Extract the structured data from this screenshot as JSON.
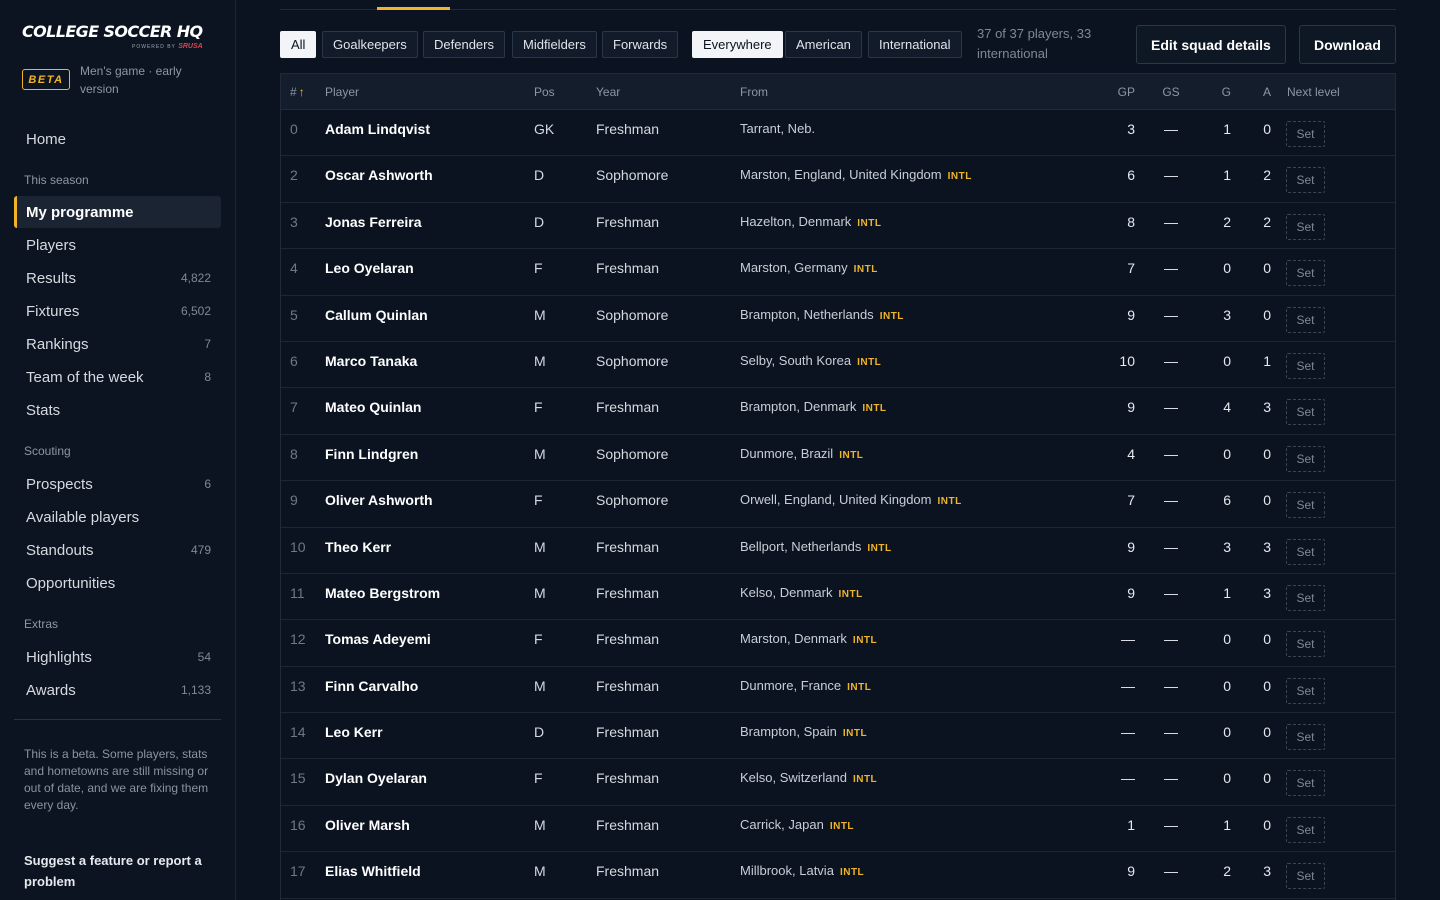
{
  "app": {
    "logo_main": "COLLEGE SOCCER HQ",
    "logo_powered": "POWERED BY",
    "logo_brand": "SRUSA",
    "beta_label": "BETA",
    "beta_text": "Men's game · early version"
  },
  "sidebar": {
    "home": "Home",
    "section_season": "This season",
    "season_items": [
      {
        "label": "My programme",
        "count": ""
      },
      {
        "label": "Players",
        "count": ""
      },
      {
        "label": "Results",
        "count": "4,822"
      },
      {
        "label": "Fixtures",
        "count": "6,502"
      },
      {
        "label": "Rankings",
        "count": "7"
      },
      {
        "label": "Team of the week",
        "count": "8"
      },
      {
        "label": "Stats",
        "count": ""
      }
    ],
    "section_scouting": "Scouting",
    "scouting_items": [
      {
        "label": "Prospects",
        "count": "6"
      },
      {
        "label": "Available players",
        "count": ""
      },
      {
        "label": "Standouts",
        "count": "479"
      },
      {
        "label": "Opportunities",
        "count": ""
      }
    ],
    "section_extras": "Extras",
    "extras_items": [
      {
        "label": "Highlights",
        "count": "54"
      },
      {
        "label": "Awards",
        "count": "1,133"
      }
    ],
    "note": "This is a beta. Some players, stats and hometowns are still missing or out of date, and we are fixing them every day.",
    "feedback_link": "Suggest a feature or report a problem"
  },
  "filters": {
    "positions": [
      "All",
      "Goalkeepers",
      "Defenders",
      "Midfielders",
      "Forwards"
    ],
    "origins": [
      "Everywhere",
      "American",
      "International"
    ],
    "selected_position": "All",
    "selected_origin": "Everywhere",
    "count_text": "37 of 37 players, 33 international"
  },
  "actions": {
    "edit": "Edit squad details",
    "download": "Download"
  },
  "table": {
    "headers": {
      "num": "#",
      "sort_arrow": "↑",
      "player": "Player",
      "pos": "Pos",
      "year": "Year",
      "from": "From",
      "gp": "GP",
      "gs": "GS",
      "g": "G",
      "a": "A",
      "next": "Next level"
    },
    "intl_label": "INTL",
    "set_label": "Set",
    "rows": [
      {
        "num": "0",
        "player": "Adam Lindqvist",
        "pos": "GK",
        "year": "Freshman",
        "from": "Tarrant, Neb.",
        "intl": false,
        "gp": "3",
        "gs": "—",
        "g": "1",
        "a": "0"
      },
      {
        "num": "2",
        "player": "Oscar Ashworth",
        "pos": "D",
        "year": "Sophomore",
        "from": "Marston, England, United Kingdom",
        "intl": true,
        "gp": "6",
        "gs": "—",
        "g": "1",
        "a": "2"
      },
      {
        "num": "3",
        "player": "Jonas Ferreira",
        "pos": "D",
        "year": "Freshman",
        "from": "Hazelton, Denmark",
        "intl": true,
        "gp": "8",
        "gs": "—",
        "g": "2",
        "a": "2"
      },
      {
        "num": "4",
        "player": "Leo Oyelaran",
        "pos": "F",
        "year": "Freshman",
        "from": "Marston, Germany",
        "intl": true,
        "gp": "7",
        "gs": "—",
        "g": "0",
        "a": "0"
      },
      {
        "num": "5",
        "player": "Callum Quinlan",
        "pos": "M",
        "year": "Sophomore",
        "from": "Brampton, Netherlands",
        "intl": true,
        "gp": "9",
        "gs": "—",
        "g": "3",
        "a": "0"
      },
      {
        "num": "6",
        "player": "Marco Tanaka",
        "pos": "M",
        "year": "Sophomore",
        "from": "Selby, South Korea",
        "intl": true,
        "gp": "10",
        "gs": "—",
        "g": "0",
        "a": "1"
      },
      {
        "num": "7",
        "player": "Mateo Quinlan",
        "pos": "F",
        "year": "Freshman",
        "from": "Brampton, Denmark",
        "intl": true,
        "gp": "9",
        "gs": "—",
        "g": "4",
        "a": "3"
      },
      {
        "num": "8",
        "player": "Finn Lindgren",
        "pos": "M",
        "year": "Sophomore",
        "from": "Dunmore, Brazil",
        "intl": true,
        "gp": "4",
        "gs": "—",
        "g": "0",
        "a": "0"
      },
      {
        "num": "9",
        "player": "Oliver Ashworth",
        "pos": "F",
        "year": "Sophomore",
        "from": "Orwell, England, United Kingdom",
        "intl": true,
        "gp": "7",
        "gs": "—",
        "g": "6",
        "a": "0"
      },
      {
        "num": "10",
        "player": "Theo Kerr",
        "pos": "M",
        "year": "Freshman",
        "from": "Bellport, Netherlands",
        "intl": true,
        "gp": "9",
        "gs": "—",
        "g": "3",
        "a": "3"
      },
      {
        "num": "11",
        "player": "Mateo Bergstrom",
        "pos": "M",
        "year": "Freshman",
        "from": "Kelso, Denmark",
        "intl": true,
        "gp": "9",
        "gs": "—",
        "g": "1",
        "a": "3"
      },
      {
        "num": "12",
        "player": "Tomas Adeyemi",
        "pos": "F",
        "year": "Freshman",
        "from": "Marston, Denmark",
        "intl": true,
        "gp": "—",
        "gs": "—",
        "g": "0",
        "a": "0"
      },
      {
        "num": "13",
        "player": "Finn Carvalho",
        "pos": "M",
        "year": "Freshman",
        "from": "Dunmore, France",
        "intl": true,
        "gp": "—",
        "gs": "—",
        "g": "0",
        "a": "0"
      },
      {
        "num": "14",
        "player": "Leo Kerr",
        "pos": "D",
        "year": "Freshman",
        "from": "Brampton, Spain",
        "intl": true,
        "gp": "—",
        "gs": "—",
        "g": "0",
        "a": "0"
      },
      {
        "num": "15",
        "player": "Dylan Oyelaran",
        "pos": "F",
        "year": "Freshman",
        "from": "Kelso, Switzerland",
        "intl": true,
        "gp": "—",
        "gs": "—",
        "g": "0",
        "a": "0"
      },
      {
        "num": "16",
        "player": "Oliver Marsh",
        "pos": "M",
        "year": "Freshman",
        "from": "Carrick, Japan",
        "intl": true,
        "gp": "1",
        "gs": "—",
        "g": "1",
        "a": "0"
      },
      {
        "num": "17",
        "player": "Elias Whitfield",
        "pos": "M",
        "year": "Freshman",
        "from": "Millbrook, Latvia",
        "intl": true,
        "gp": "9",
        "gs": "—",
        "g": "2",
        "a": "3"
      }
    ]
  }
}
